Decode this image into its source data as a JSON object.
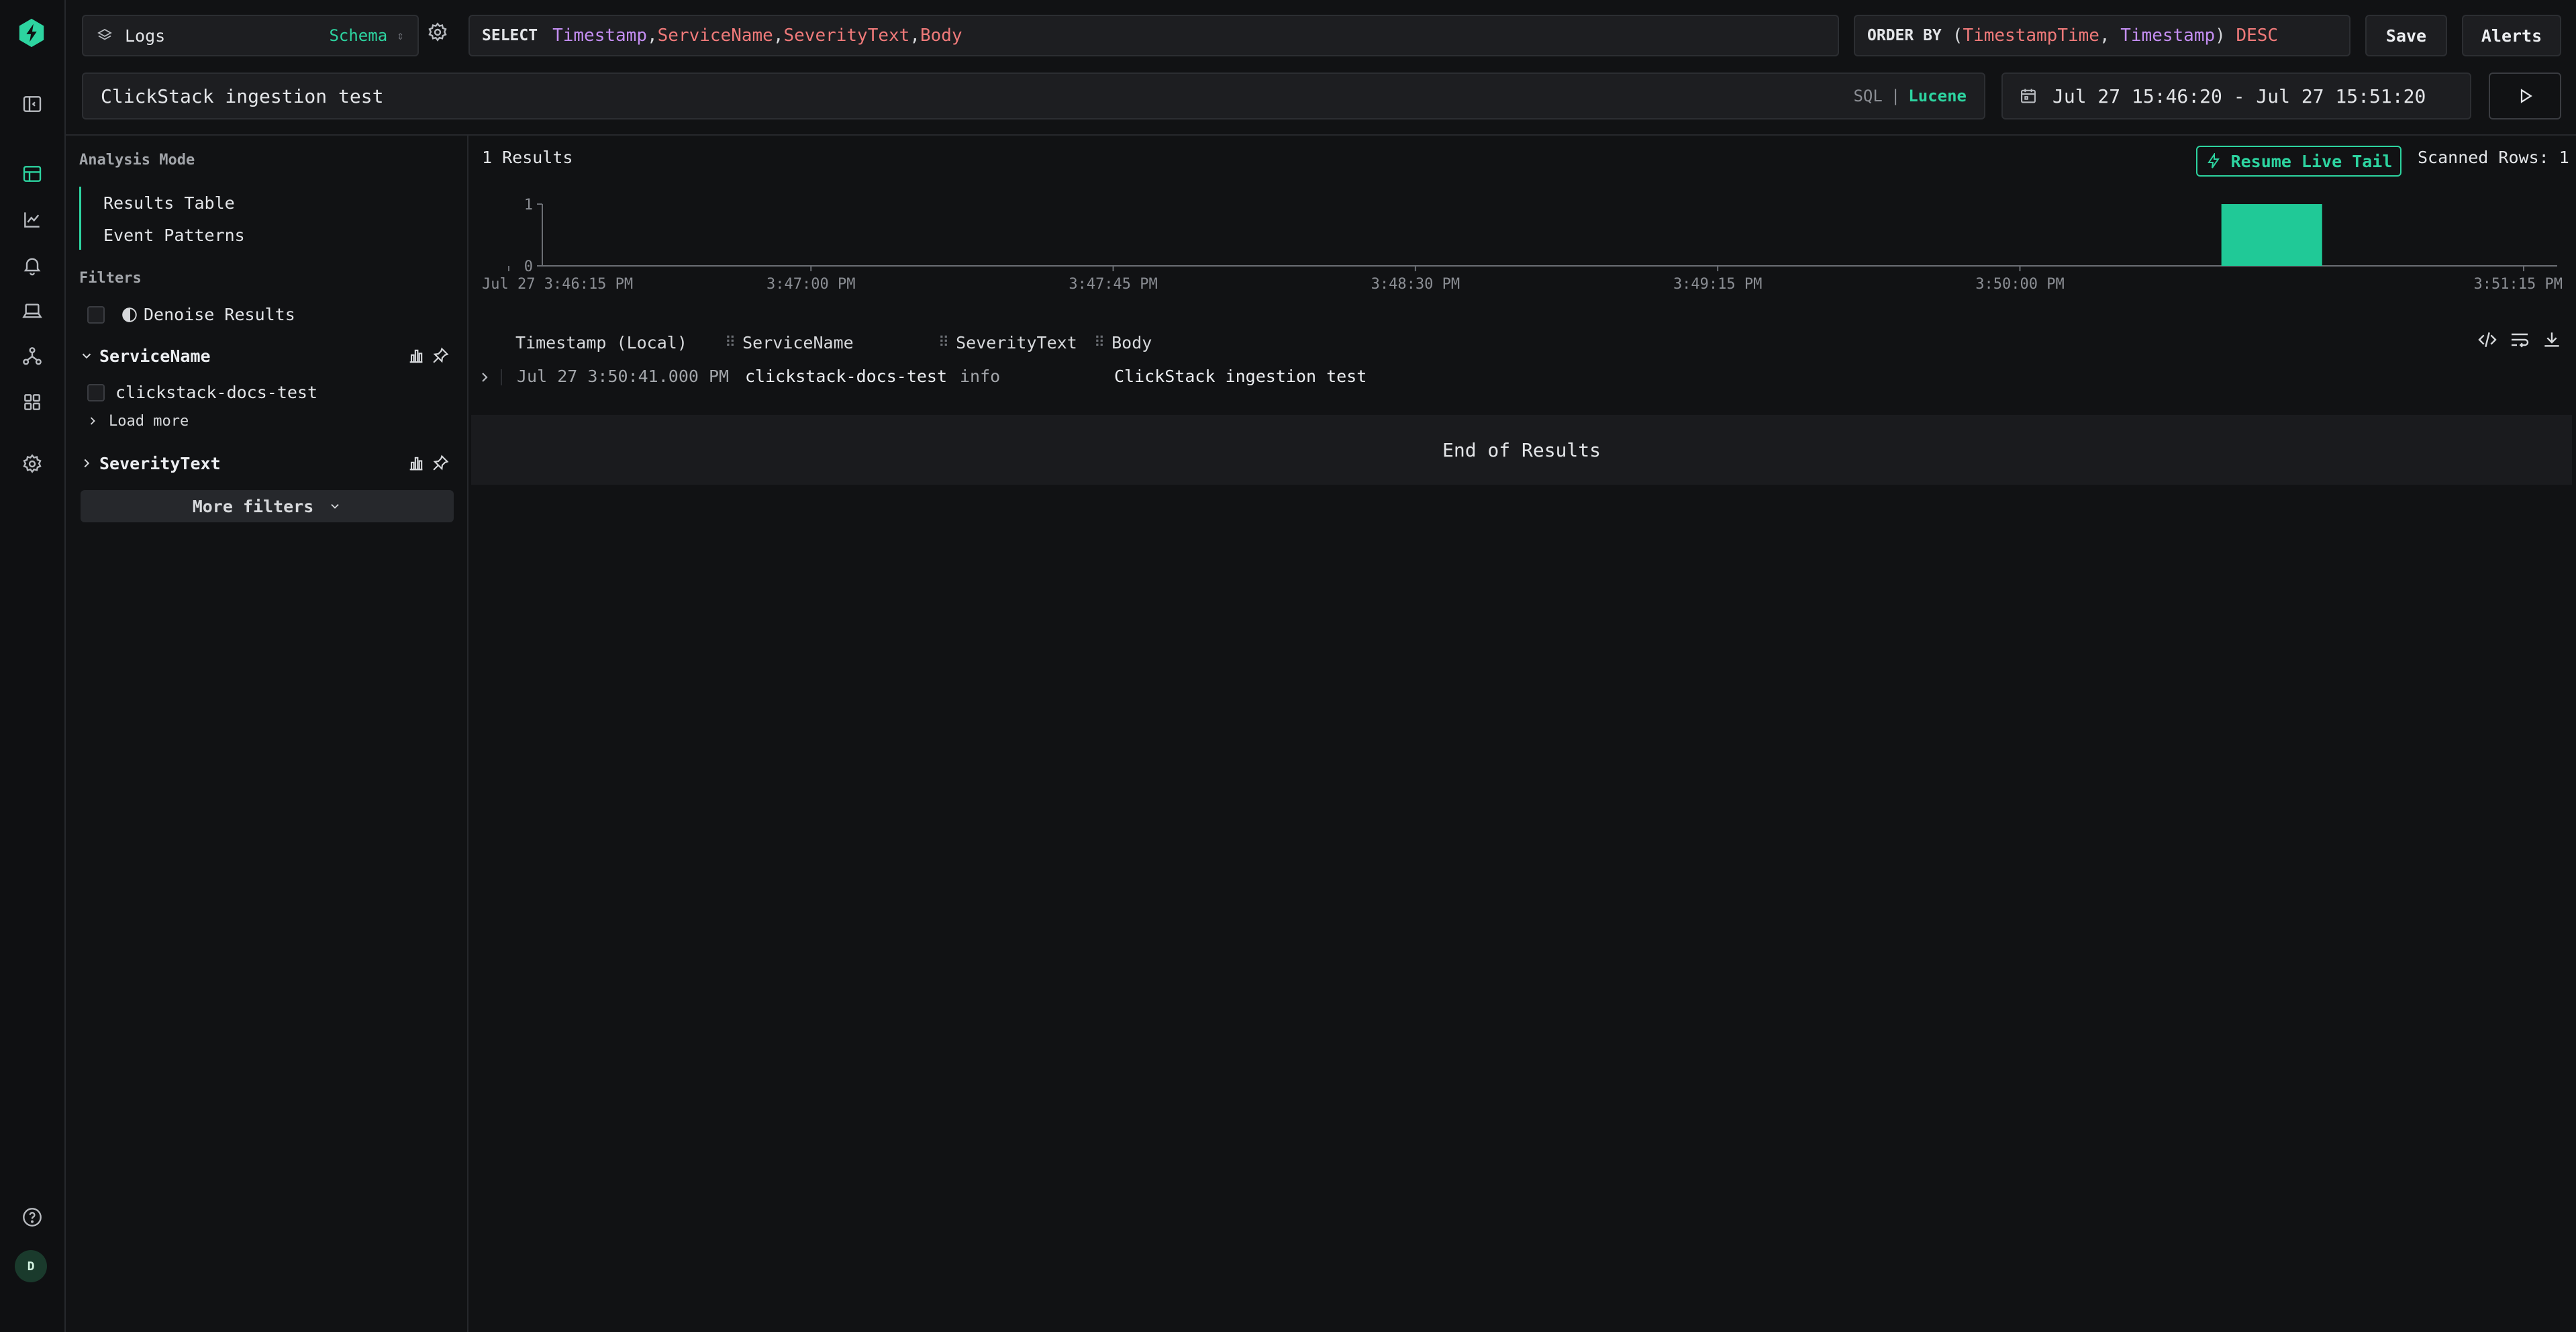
{
  "source": {
    "label": "Logs",
    "schema_label": "Schema"
  },
  "select": {
    "keyword": "SELECT",
    "cols": [
      "Timestamp",
      "ServiceName",
      "SeverityText",
      "Body"
    ]
  },
  "order_by": {
    "keyword": "ORDER BY",
    "open": "(",
    "col1": "TimestampTime",
    "col2": "Timestamp",
    "close": ")",
    "dir": "DESC"
  },
  "toolbar": {
    "save_label": "Save",
    "alerts_label": "Alerts"
  },
  "search": {
    "value": "ClickStack ingestion test",
    "mode_sql": "SQL",
    "mode_sep": "|",
    "mode_lucene": "Lucene"
  },
  "time_range": {
    "value": "Jul 27 15:46:20 - Jul 27 15:51:20"
  },
  "sidebar": {
    "analysis_title": "Analysis Mode",
    "modes": [
      "Results Table",
      "Event Patterns"
    ],
    "filters_title": "Filters",
    "denoise_label": "Denoise Results",
    "facets": [
      {
        "name": "ServiceName",
        "expanded": true,
        "values": [
          "clickstack-docs-test"
        ],
        "load_more": "Load more"
      },
      {
        "name": "SeverityText",
        "expanded": false
      }
    ],
    "more_filters": "More filters"
  },
  "results": {
    "count_label": "1 Results",
    "live_tail_label": "Resume Live Tail",
    "scanned_label": "Scanned Rows: 1",
    "end_label": "End of Results",
    "columns": [
      "Timestamp (Local)",
      "ServiceName",
      "SeverityText",
      "Body"
    ],
    "rows": [
      [
        "Jul 27 3:50:41.000 PM",
        "clickstack-docs-test",
        "info",
        "ClickStack ingestion test"
      ]
    ]
  },
  "colors": {
    "accent": "#2dd4a0",
    "keyword_purple": "#c48ef2",
    "keyword_red": "#f07a7a",
    "background": "#111214"
  },
  "chart_data": {
    "type": "bar",
    "x_ticks": [
      "Jul 27 3:46:15 PM",
      "3:47:00 PM",
      "3:47:45 PM",
      "3:48:30 PM",
      "3:49:15 PM",
      "3:50:00 PM",
      "3:51:15 PM"
    ],
    "y_ticks": [
      "1",
      "0"
    ],
    "ylim": [
      0,
      1
    ],
    "bars": [
      {
        "start": "3:50:30 PM",
        "end": "3:50:45 PM",
        "value": 1
      }
    ],
    "color": "#20c997"
  }
}
